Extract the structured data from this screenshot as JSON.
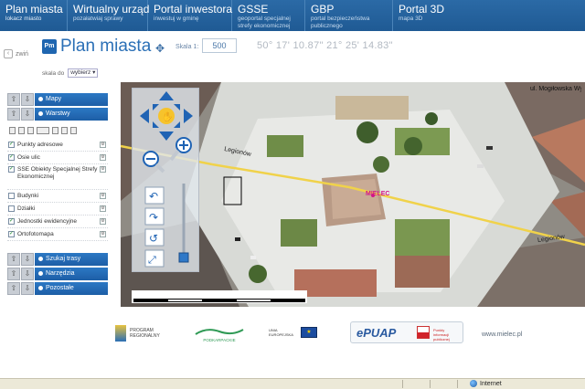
{
  "nav": [
    {
      "title": "Plan miasta",
      "subtitle": "lokacz miasto"
    },
    {
      "title": "Wirtualny urząd",
      "subtitle": "pozałatwiaj sprawy"
    },
    {
      "title": "Portal inwestora",
      "subtitle": "inwestuj w gminę"
    },
    {
      "title": "GSSE",
      "subtitle": "geoportal specjalnej strefy ekonomicznej"
    },
    {
      "title": "GBP",
      "subtitle": "portal bezpieczeństwa publicznego"
    },
    {
      "title": "Portal 3D",
      "subtitle": "mapa 3D"
    }
  ],
  "header": {
    "back_label": "zwiń",
    "badge": "Pm",
    "title": "Plan miasta",
    "scale_label": "Skala 1:",
    "scale_value": "500",
    "coordinates": "50° 17' 10.87\" 21° 25' 14.83\""
  },
  "sidebar": {
    "chooser_label": "skala do",
    "chooser_value": "wybierz",
    "panels": {
      "mapy": "Mapy",
      "warstwy": "Warstwy",
      "szukaj": "Szukaj trasy",
      "narzedzia": "Narzędzia",
      "pozostale": "Pozostałe"
    },
    "layers": [
      {
        "name": "Punkty adresowe",
        "checked": true
      },
      {
        "name": "Osie ulic",
        "checked": true
      },
      {
        "name": "SSE Obiekty Specjalnej Strefy Ekonomicznej",
        "checked": true
      },
      {
        "name": "Budynki",
        "checked": false
      },
      {
        "name": "Działki",
        "checked": false
      },
      {
        "name": "Jednostki ewidencyjne",
        "checked": true
      },
      {
        "name": "Ortofotomapa",
        "checked": true
      }
    ]
  },
  "map": {
    "labels": {
      "legionow_left": "Legionów",
      "legionow_right": "Legionów",
      "mielec": "MIELEC",
      "street_top_right": "ul. Mogiłowska Wygwerowa"
    },
    "colors": {
      "road": "#f0d24a",
      "marker": "#d2148a"
    }
  },
  "logos": {
    "program": "PROGRAM REGIONALNY",
    "podkarpackie": "PODKARPACKIE",
    "ue": "UNIA EUROPEJSKA",
    "epuap": "ePUAP",
    "epuap_text": "Punkty informacji publicznej",
    "www": "www.mielec.pl"
  },
  "status": {
    "zone": "Internet"
  }
}
